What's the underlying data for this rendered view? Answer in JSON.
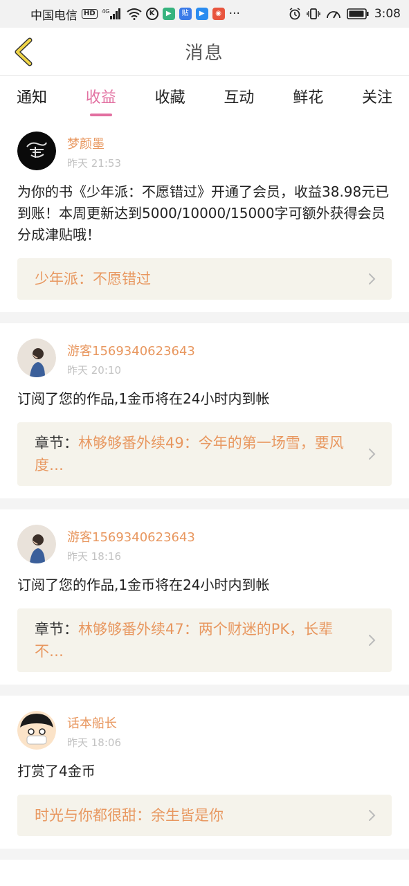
{
  "status_bar": {
    "carrier": "中国电信",
    "hd": "HD",
    "net": "4G",
    "more": "···",
    "time": "3:08"
  },
  "header": {
    "title": "消息",
    "back_icon": "chevron-left-icon"
  },
  "tabs": [
    {
      "label": "通知",
      "active": false
    },
    {
      "label": "收益",
      "active": true
    },
    {
      "label": "收藏",
      "active": false
    },
    {
      "label": "互动",
      "active": false
    },
    {
      "label": "鲜花",
      "active": false
    },
    {
      "label": "关注",
      "active": false
    }
  ],
  "messages": [
    {
      "username": "梦颜墨",
      "time": "昨天 21:53",
      "text": "为你的书《少年派：不愿错过》开通了会员，收益38.98元已到账！本周更新达到5000/10000/15000字可额外获得会员分成津贴哦！",
      "link_prefix": "",
      "link": "少年派：不愿错过",
      "avatar": "ink-logo-avatar"
    },
    {
      "username": "游客1569340623643",
      "time": "昨天 20:10",
      "text": "订阅了您的作品,1金币将在24小时内到帐",
      "link_prefix": "章节：",
      "link": "林够够番外续49：今年的第一场雪，要风度…",
      "avatar": "girl-avatar"
    },
    {
      "username": "游客1569340623643",
      "time": "昨天 18:16",
      "text": "订阅了您的作品,1金币将在24小时内到帐",
      "link_prefix": "章节：",
      "link": "林够够番外续47：两个财迷的PK，长辈不…",
      "avatar": "girl-avatar"
    },
    {
      "username": "话本船长",
      "time": "昨天 18:06",
      "text": "打赏了4金币",
      "link_prefix": "",
      "link": "时光与你都很甜：余生皆是你",
      "avatar": "pirate-avatar"
    }
  ],
  "colors": {
    "accent": "#e26fa0",
    "username": "#e8975f",
    "link_bg": "#f5f3eb",
    "back_arrow": "#f0d548"
  }
}
